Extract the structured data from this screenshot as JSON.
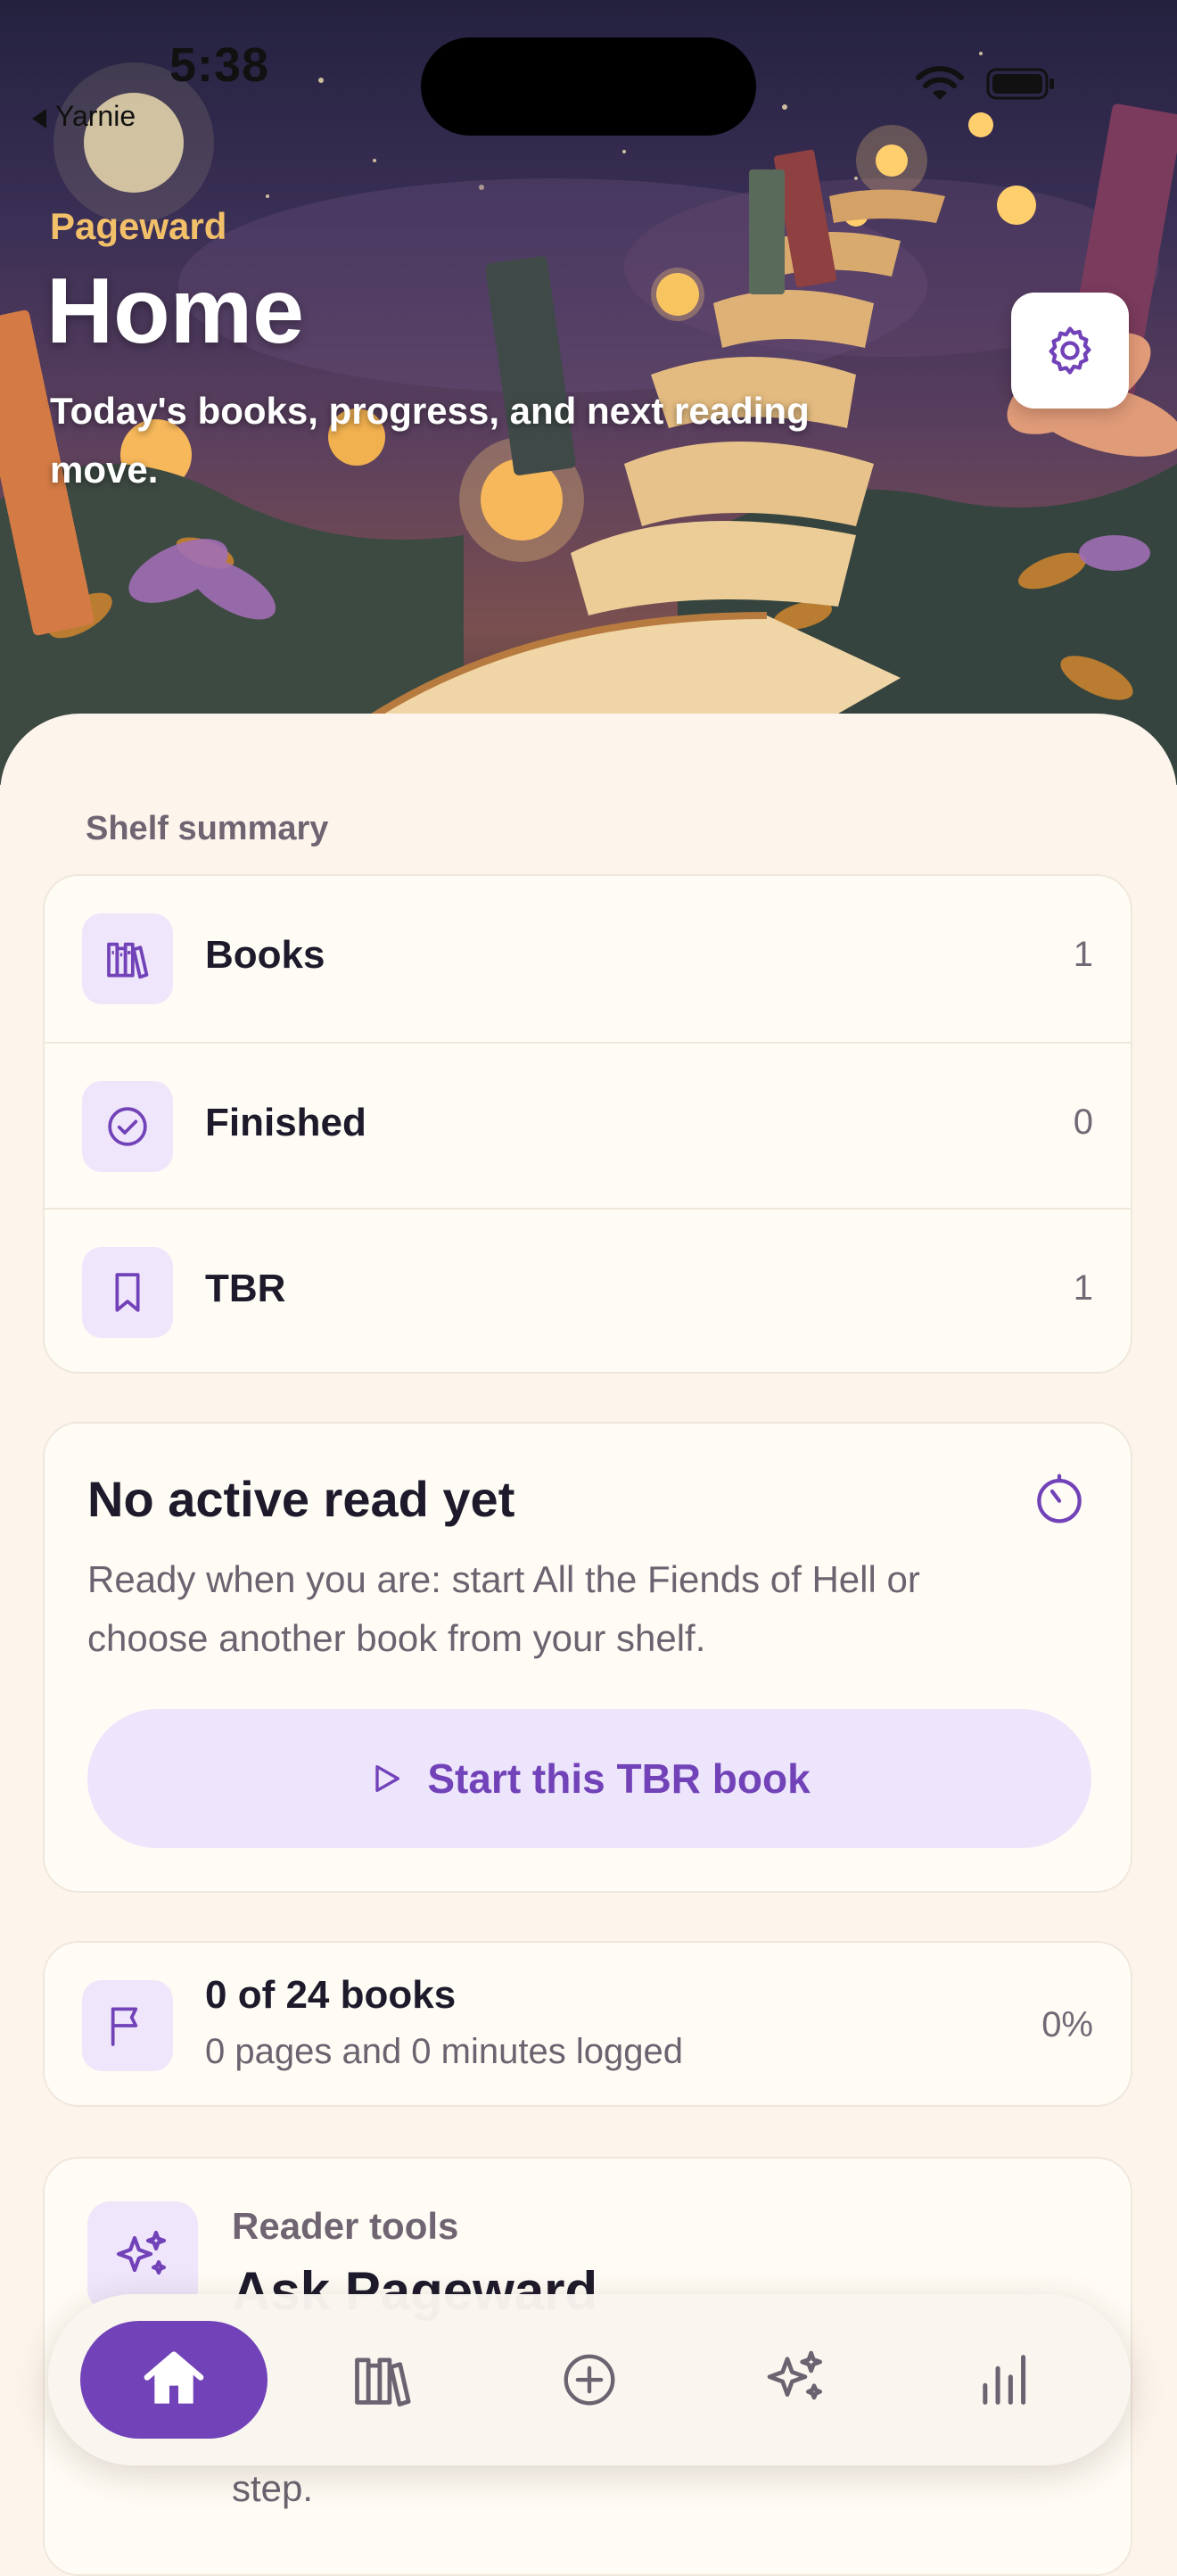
{
  "status_bar": {
    "time": "5:38",
    "back_app": "Yarnie"
  },
  "header": {
    "brand": "Pageward",
    "title": "Home",
    "subtitle": "Today's books, progress, and next reading move."
  },
  "shelf_summary": {
    "label": "Shelf summary",
    "rows": [
      {
        "label": "Books",
        "count": "1",
        "icon": "bookshelf-icon"
      },
      {
        "label": "Finished",
        "count": "0",
        "icon": "check-circle-icon"
      },
      {
        "label": "TBR",
        "count": "1",
        "icon": "bookmark-icon"
      }
    ]
  },
  "active_read": {
    "title": "No active read yet",
    "description": "Ready when you are: start All the Fiends of Hell or choose another book from your shelf.",
    "button_label": "Start this TBR book"
  },
  "reading_goal": {
    "title": "0 of 24 books",
    "subtitle": "0 pages and 0 minutes logged",
    "percent": "0%",
    "progress": 0
  },
  "reader_tools": {
    "kicker": "Reader tools",
    "title": "Ask Pageward",
    "tail": "step."
  },
  "tab_bar": {
    "tabs": [
      "home-icon",
      "library-icon",
      "add-icon",
      "sparkles-icon",
      "stats-icon"
    ],
    "active": 0
  },
  "colors": {
    "accent": "#7242b8",
    "accent_soft": "#ece5fb",
    "brand_gold": "#f3c06a",
    "background": "#fdf5ec"
  }
}
